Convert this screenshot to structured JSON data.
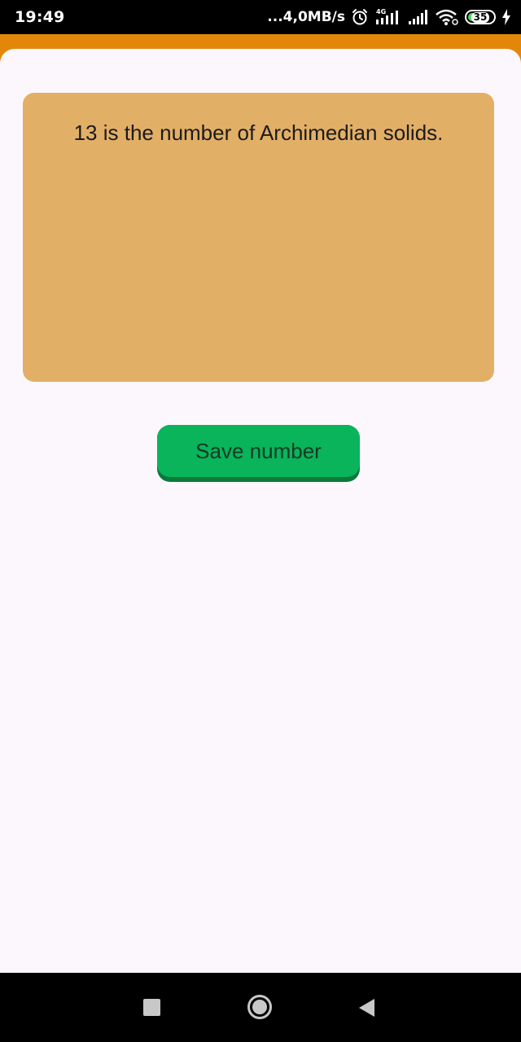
{
  "status_bar": {
    "time": "19:49",
    "net_speed": "...4,0MB/s",
    "network_type": "4G",
    "battery_level": "35",
    "icons": [
      "alarm-icon",
      "signal-4g-icon",
      "signal-icon",
      "wifi-icon",
      "battery-icon",
      "charging-icon"
    ],
    "battery_fill_percent": 35
  },
  "colors": {
    "app_bar": "#e3870b",
    "card_background": "#e2af67",
    "button_background": "#09b45b",
    "page_background": "#fcf7fd"
  },
  "main": {
    "fact_text": "13 is the number of Archimedian solids.",
    "save_button_label": "Save number"
  },
  "nav_bar": {
    "icons": [
      "recents-square-icon",
      "home-circle-icon",
      "back-triangle-icon"
    ]
  }
}
